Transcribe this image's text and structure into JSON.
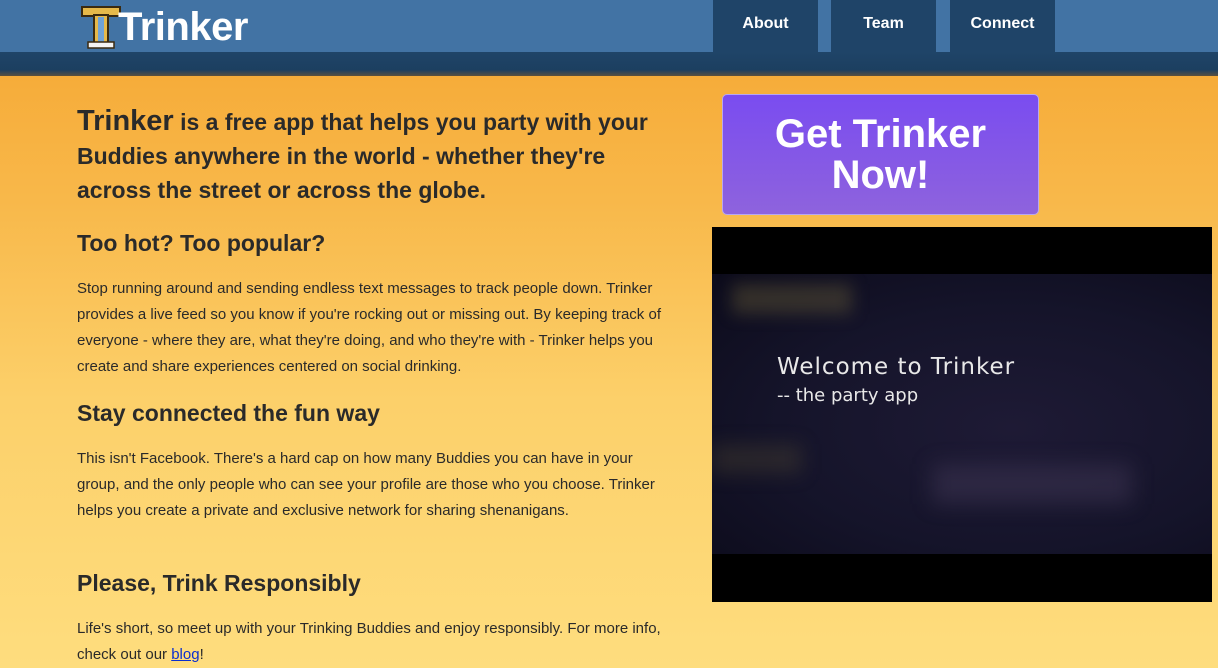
{
  "header": {
    "logo_text": "Trinker",
    "nav": [
      {
        "label": "About"
      },
      {
        "label": "Team"
      },
      {
        "label": "Connect"
      }
    ]
  },
  "intro": {
    "brand": "Trinker",
    "text": " is a free app that helps you party with your Buddies anywhere in the world - whether they're across the street or across the globe."
  },
  "sections": [
    {
      "heading": "Too hot? Too popular?",
      "body": "Stop running around and sending endless text messages to track people down. Trinker provides a live feed so you know if you're rocking out or missing out. By keeping track of everyone - where they are, what they're doing, and who they're with - Trinker helps you create and share experiences centered on social drinking."
    },
    {
      "heading": "Stay connected the fun way",
      "body": "This isn't Facebook. There's a hard cap on how many Buddies you can have in your group, and the only people who can see your profile are those who you choose. Trinker helps you create a private and exclusive network for sharing shenanigans."
    },
    {
      "heading": "Please, Trink Responsibly",
      "body_before": "Life's short, so meet up with your Trinking Buddies and enjoy responsibly. For more info, check out our ",
      "link": "blog",
      "body_after": "!"
    }
  ],
  "cta": {
    "label": "Get Trinker Now!"
  },
  "video": {
    "title": "Welcome to Trinker",
    "subtitle": "-- the party app"
  },
  "colors": {
    "header": "#4273a4",
    "nav_active": "#1f4468",
    "cta": "#7a4cf0",
    "link": "#0b2fcf"
  }
}
